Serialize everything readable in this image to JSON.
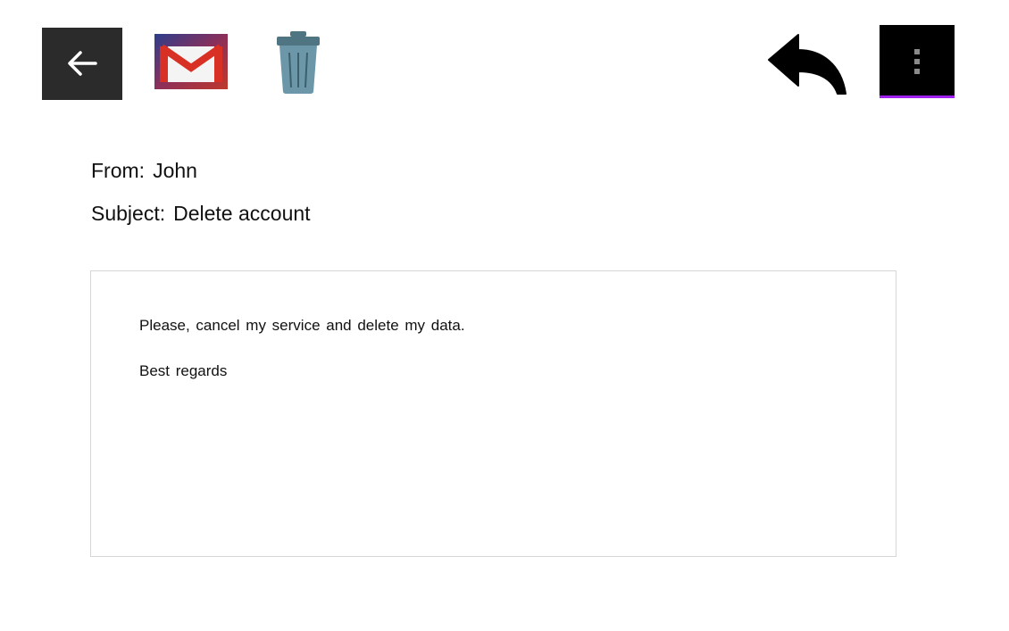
{
  "toolbar": {
    "icons": {
      "back": "arrow-left-icon",
      "gmail": "gmail-icon",
      "trash": "trash-icon",
      "reply": "reply-icon",
      "more": "more-vertical-icon"
    },
    "colors": {
      "back_bg": "#2b2b2b",
      "trash": "#6b97a8",
      "more_bg": "#000000",
      "more_accent": "#a020f0"
    }
  },
  "email": {
    "from_label": "From:",
    "from_value": "John",
    "subject_label": "Subject:",
    "subject_value": "Delete account",
    "body": {
      "line1": "Please, cancel my service and delete my data.",
      "line2": "Best regards"
    }
  }
}
